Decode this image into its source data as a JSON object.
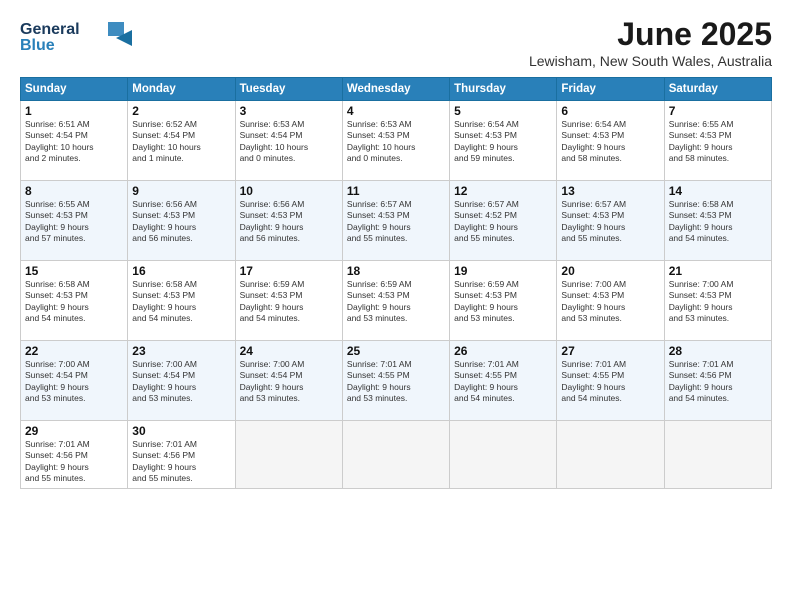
{
  "header": {
    "logo_line1": "General",
    "logo_line2": "Blue",
    "month": "June 2025",
    "location": "Lewisham, New South Wales, Australia"
  },
  "days_of_week": [
    "Sunday",
    "Monday",
    "Tuesday",
    "Wednesday",
    "Thursday",
    "Friday",
    "Saturday"
  ],
  "weeks": [
    [
      {
        "day": "1",
        "info": "Sunrise: 6:51 AM\nSunset: 4:54 PM\nDaylight: 10 hours\nand 2 minutes."
      },
      {
        "day": "2",
        "info": "Sunrise: 6:52 AM\nSunset: 4:54 PM\nDaylight: 10 hours\nand 1 minute."
      },
      {
        "day": "3",
        "info": "Sunrise: 6:53 AM\nSunset: 4:54 PM\nDaylight: 10 hours\nand 0 minutes."
      },
      {
        "day": "4",
        "info": "Sunrise: 6:53 AM\nSunset: 4:53 PM\nDaylight: 10 hours\nand 0 minutes."
      },
      {
        "day": "5",
        "info": "Sunrise: 6:54 AM\nSunset: 4:53 PM\nDaylight: 9 hours\nand 59 minutes."
      },
      {
        "day": "6",
        "info": "Sunrise: 6:54 AM\nSunset: 4:53 PM\nDaylight: 9 hours\nand 58 minutes."
      },
      {
        "day": "7",
        "info": "Sunrise: 6:55 AM\nSunset: 4:53 PM\nDaylight: 9 hours\nand 58 minutes."
      }
    ],
    [
      {
        "day": "8",
        "info": "Sunrise: 6:55 AM\nSunset: 4:53 PM\nDaylight: 9 hours\nand 57 minutes."
      },
      {
        "day": "9",
        "info": "Sunrise: 6:56 AM\nSunset: 4:53 PM\nDaylight: 9 hours\nand 56 minutes."
      },
      {
        "day": "10",
        "info": "Sunrise: 6:56 AM\nSunset: 4:53 PM\nDaylight: 9 hours\nand 56 minutes."
      },
      {
        "day": "11",
        "info": "Sunrise: 6:57 AM\nSunset: 4:53 PM\nDaylight: 9 hours\nand 55 minutes."
      },
      {
        "day": "12",
        "info": "Sunrise: 6:57 AM\nSunset: 4:52 PM\nDaylight: 9 hours\nand 55 minutes."
      },
      {
        "day": "13",
        "info": "Sunrise: 6:57 AM\nSunset: 4:53 PM\nDaylight: 9 hours\nand 55 minutes."
      },
      {
        "day": "14",
        "info": "Sunrise: 6:58 AM\nSunset: 4:53 PM\nDaylight: 9 hours\nand 54 minutes."
      }
    ],
    [
      {
        "day": "15",
        "info": "Sunrise: 6:58 AM\nSunset: 4:53 PM\nDaylight: 9 hours\nand 54 minutes."
      },
      {
        "day": "16",
        "info": "Sunrise: 6:58 AM\nSunset: 4:53 PM\nDaylight: 9 hours\nand 54 minutes."
      },
      {
        "day": "17",
        "info": "Sunrise: 6:59 AM\nSunset: 4:53 PM\nDaylight: 9 hours\nand 54 minutes."
      },
      {
        "day": "18",
        "info": "Sunrise: 6:59 AM\nSunset: 4:53 PM\nDaylight: 9 hours\nand 53 minutes."
      },
      {
        "day": "19",
        "info": "Sunrise: 6:59 AM\nSunset: 4:53 PM\nDaylight: 9 hours\nand 53 minutes."
      },
      {
        "day": "20",
        "info": "Sunrise: 7:00 AM\nSunset: 4:53 PM\nDaylight: 9 hours\nand 53 minutes."
      },
      {
        "day": "21",
        "info": "Sunrise: 7:00 AM\nSunset: 4:53 PM\nDaylight: 9 hours\nand 53 minutes."
      }
    ],
    [
      {
        "day": "22",
        "info": "Sunrise: 7:00 AM\nSunset: 4:54 PM\nDaylight: 9 hours\nand 53 minutes."
      },
      {
        "day": "23",
        "info": "Sunrise: 7:00 AM\nSunset: 4:54 PM\nDaylight: 9 hours\nand 53 minutes."
      },
      {
        "day": "24",
        "info": "Sunrise: 7:00 AM\nSunset: 4:54 PM\nDaylight: 9 hours\nand 53 minutes."
      },
      {
        "day": "25",
        "info": "Sunrise: 7:01 AM\nSunset: 4:55 PM\nDaylight: 9 hours\nand 53 minutes."
      },
      {
        "day": "26",
        "info": "Sunrise: 7:01 AM\nSunset: 4:55 PM\nDaylight: 9 hours\nand 54 minutes."
      },
      {
        "day": "27",
        "info": "Sunrise: 7:01 AM\nSunset: 4:55 PM\nDaylight: 9 hours\nand 54 minutes."
      },
      {
        "day": "28",
        "info": "Sunrise: 7:01 AM\nSunset: 4:56 PM\nDaylight: 9 hours\nand 54 minutes."
      }
    ],
    [
      {
        "day": "29",
        "info": "Sunrise: 7:01 AM\nSunset: 4:56 PM\nDaylight: 9 hours\nand 55 minutes."
      },
      {
        "day": "30",
        "info": "Sunrise: 7:01 AM\nSunset: 4:56 PM\nDaylight: 9 hours\nand 55 minutes."
      },
      {
        "day": "",
        "info": ""
      },
      {
        "day": "",
        "info": ""
      },
      {
        "day": "",
        "info": ""
      },
      {
        "day": "",
        "info": ""
      },
      {
        "day": "",
        "info": ""
      }
    ]
  ]
}
